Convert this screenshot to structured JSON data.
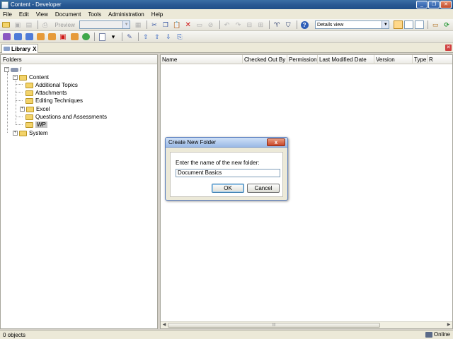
{
  "window": {
    "title": "Content - Developer"
  },
  "menu": [
    "File",
    "Edit",
    "View",
    "Document",
    "Tools",
    "Administration",
    "Help"
  ],
  "toolbar": {
    "preview_label": "Preview",
    "view_select": "Details view"
  },
  "tabs": {
    "library_label": "Library",
    "close_glyph": "X"
  },
  "folders_pane": {
    "header": "Folders",
    "root": "/",
    "tree": {
      "content": "Content",
      "children": [
        "Additional Topics",
        "Attachments",
        "Editing Techniques",
        "Excel",
        "Questions and Assessments",
        "WP"
      ],
      "system": "System"
    },
    "selected": "WP"
  },
  "list_pane": {
    "columns": [
      "Name",
      "Checked Out By",
      "Permission",
      "Last Modified Date",
      "Version",
      "Type",
      "R"
    ]
  },
  "status": {
    "objects": "0 objects",
    "connection": "Online"
  },
  "dialog": {
    "title": "Create New Folder",
    "close_glyph": "x",
    "prompt": "Enter the name of the new folder:",
    "input_value": "Document Basics",
    "ok_label": "OK",
    "cancel_label": "Cancel"
  },
  "icons": [
    "app-icon",
    "folder-icon",
    "document-icon",
    "save-icon",
    "cut-icon",
    "copy-icon",
    "paste-icon",
    "delete-icon",
    "undo-icon",
    "redo-icon",
    "find-icon",
    "help-icon",
    "refresh-icon",
    "online-icon"
  ]
}
